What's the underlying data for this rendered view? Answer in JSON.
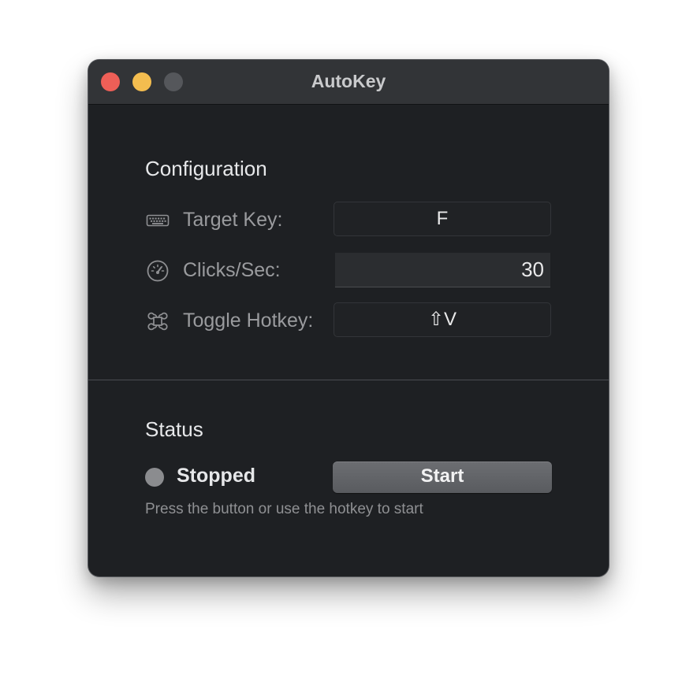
{
  "window": {
    "title": "AutoKey",
    "traffic_lights": {
      "close_color": "#ee5f57",
      "minimize_color": "#f4bd4f",
      "zoom_color": "#55575b"
    }
  },
  "configuration": {
    "heading": "Configuration",
    "rows": [
      {
        "icon": "keyboard-icon",
        "label": "Target Key:",
        "value": "F"
      },
      {
        "icon": "speedometer-icon",
        "label": "Clicks/Sec:",
        "value": "30"
      },
      {
        "icon": "command-icon",
        "label": "Toggle Hotkey:",
        "value": "⇧V"
      }
    ]
  },
  "status": {
    "heading": "Status",
    "state": "Stopped",
    "indicator_color": "#8b8c8f",
    "button_label": "Start",
    "hint": "Press the button or use the hotkey to start"
  }
}
